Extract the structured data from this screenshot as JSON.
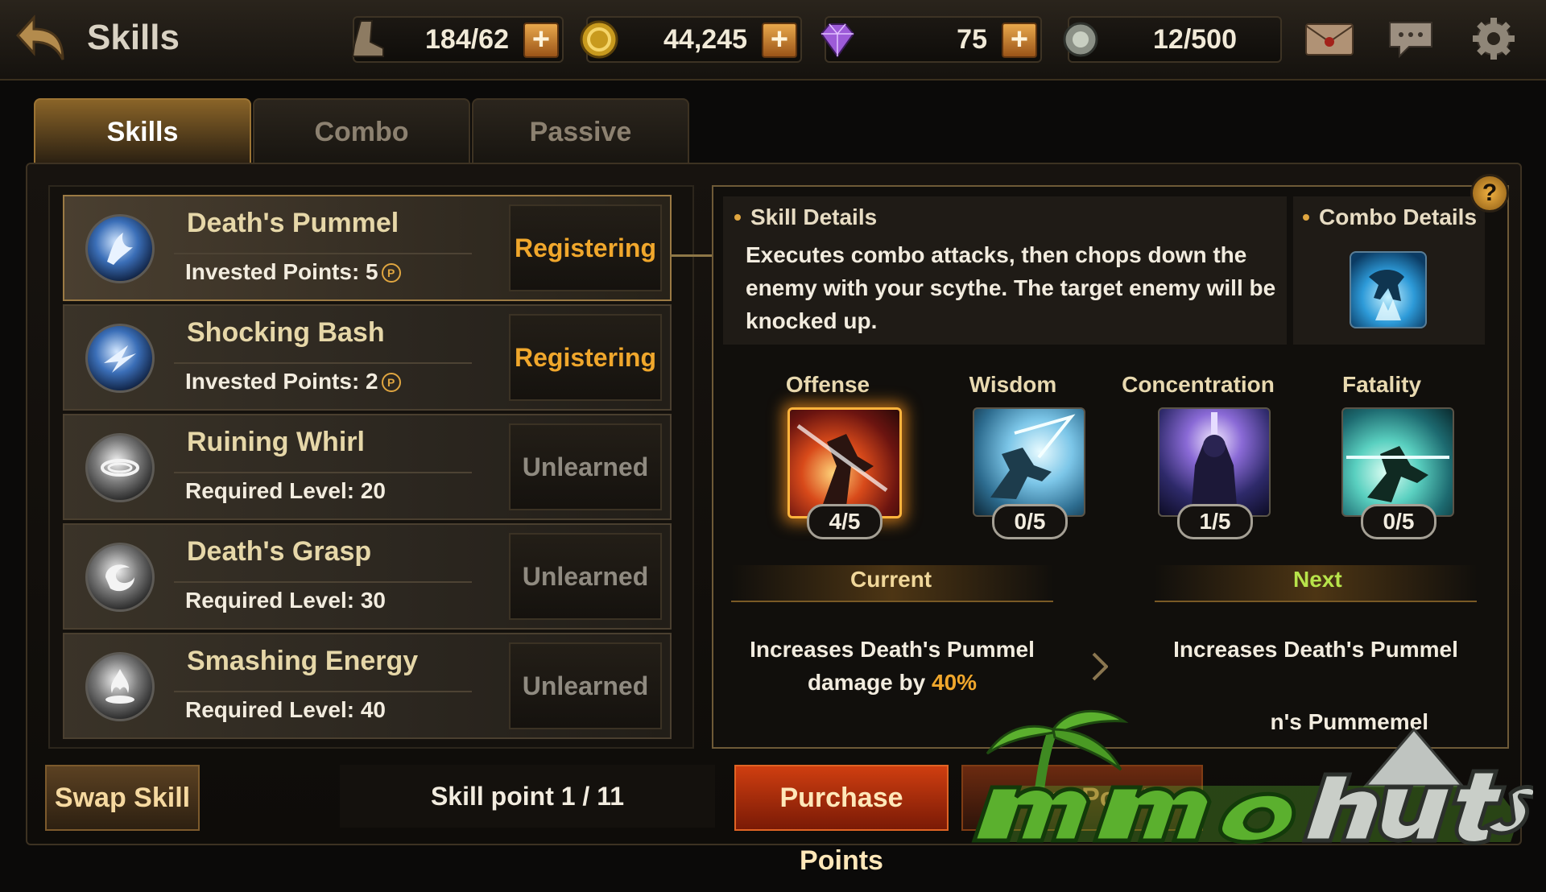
{
  "header": {
    "title": "Skills",
    "resources": [
      {
        "icon": "stamina-boot-icon",
        "value": "184/62",
        "has_plus": true
      },
      {
        "icon": "gold-coin-icon",
        "value": "44,245",
        "has_plus": true
      },
      {
        "icon": "gem-icon",
        "value": "75",
        "has_plus": true
      },
      {
        "icon": "silver-token-icon",
        "value": "12/500",
        "has_plus": false
      }
    ],
    "plus_label": "+",
    "icons": [
      "mail-icon",
      "chat-icon",
      "settings-gear-icon"
    ]
  },
  "tabs": [
    {
      "label": "Skills",
      "active": true
    },
    {
      "label": "Combo",
      "active": false
    },
    {
      "label": "Passive",
      "active": false
    }
  ],
  "skills": [
    {
      "name": "Death's Pummel",
      "sub_label": "Invested Points:",
      "sub_value": "5",
      "status": "Registering",
      "p_icon": "P"
    },
    {
      "name": "Shocking Bash",
      "sub_label": "Invested Points:",
      "sub_value": "2",
      "status": "Registering",
      "p_icon": "P"
    },
    {
      "name": "Ruining Whirl",
      "sub_label": "Required Level:",
      "sub_value": "20",
      "status": "Unlearned"
    },
    {
      "name": "Death's Grasp",
      "sub_label": "Required Level:",
      "sub_value": "30",
      "status": "Unlearned"
    },
    {
      "name": "Smashing Energy",
      "sub_label": "Required Level:",
      "sub_value": "40",
      "status": "Unlearned"
    }
  ],
  "details": {
    "skill_details_title": "Skill Details",
    "description": "Executes combo attacks, then chops down the enemy with your scythe. The target enemy will be knocked up.",
    "combo_details_title": "Combo Details",
    "help_label": "?",
    "stats": [
      {
        "label": "Offense",
        "count": "4/5",
        "level": 0.8
      },
      {
        "label": "Wisdom",
        "count": "0/5",
        "level": 0
      },
      {
        "label": "Concentration",
        "count": "1/5",
        "level": 0.2
      },
      {
        "label": "Fatality",
        "count": "0/5",
        "level": 0
      }
    ],
    "current_label": "Current",
    "next_label": "Next",
    "current_effect_line1": "Increases Death's Pummel",
    "current_effect_prefix": "damage by ",
    "current_effect_value": "40%",
    "next_effect_line1": "Increases Death's Pummel",
    "next_effect_partial": "n's Pummemel"
  },
  "footer": {
    "swap_label": "Swap Skill",
    "skill_point_label": "Skill point 1 / 11",
    "purchase_label": "Purchase Points",
    "reset_label": "Reset Points"
  },
  "colors": {
    "accent": "#f0a72c",
    "next": "#b7e34a",
    "purchase": "#cf3e10"
  }
}
